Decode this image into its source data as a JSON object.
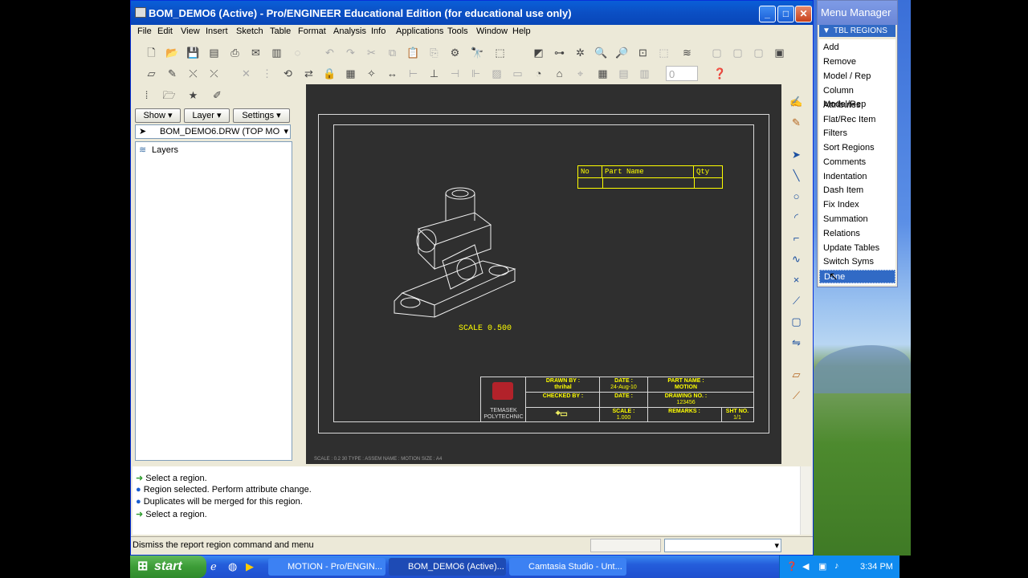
{
  "window": {
    "title": "BOM_DEMO6 (Active) - Pro/ENGINEER Educational Edition (for educational use only)",
    "minimize": "_",
    "maximize": "□",
    "close": "✕"
  },
  "menubar": [
    "File",
    "Edit",
    "View",
    "Insert",
    "Sketch",
    "Table",
    "Format",
    "Analysis",
    "Info",
    "Applications",
    "Tools",
    "Window",
    "Help"
  ],
  "panel": {
    "show_label": "Show",
    "layer_label": "Layer",
    "settings_label": "Settings",
    "model_combo": "BOM_DEMO6.DRW (TOP MOD",
    "tree_root": "Layers"
  },
  "drawing": {
    "scale_note": "SCALE  0.500",
    "bom_headers": [
      "No",
      "Part Name",
      "Qty"
    ],
    "title_block": {
      "drawn_by_label": "DRAWN BY :",
      "drawn_by_value": "thrihal",
      "checked_by_label": "CHECKED BY :",
      "date_label_1": "DATE :",
      "date_value_1": "24-Aug-10",
      "date_label_2": "DATE :",
      "part_name_label": "PART NAME :",
      "part_name_value": "MOTION",
      "drawing_no_label": "DRAWING NO. :",
      "drawing_no_value": "123456",
      "scale_label": "SCALE :",
      "scale_value": "1.000",
      "remarks_label": "REMARKS :",
      "sht_label": "SHT NO.",
      "sht_value": "1/1",
      "logo_text_1": "TEMASEK",
      "logo_text_2": "POLYTECHNIC"
    },
    "footer": "SCALE : 0.2 30     TYPE : ASSEM     NAME : MOTION     SIZE : A4"
  },
  "messages": [
    {
      "icon": "arrow",
      "text": "Select a region."
    },
    {
      "icon": "dot",
      "text": "Region selected. Perform attribute change."
    },
    {
      "icon": "dot",
      "text": "Duplicates will be merged for this region."
    },
    {
      "icon": "arrow",
      "text": "Select a region."
    }
  ],
  "status_text": "Dismiss the report region command and menu",
  "menu_manager": {
    "title": "Menu Manager",
    "submenu": "TBL REGIONS",
    "items": [
      "Add",
      "Remove",
      "Model / Rep",
      "Column Model/Rep",
      "Attributes",
      "Flat/Rec Item",
      "Filters",
      "Sort Regions",
      "Comments",
      "Indentation",
      "Dash Item",
      "Fix Index",
      "Summation",
      "Relations",
      "Update Tables",
      "Switch Syms",
      "Done"
    ],
    "selected": "Done"
  },
  "taskbar": {
    "start": "start",
    "tasks": [
      "MOTION - Pro/ENGIN...",
      "BOM_DEMO6 (Active)...",
      "Camtasia Studio - Unt..."
    ],
    "clock": "3:34 PM"
  }
}
